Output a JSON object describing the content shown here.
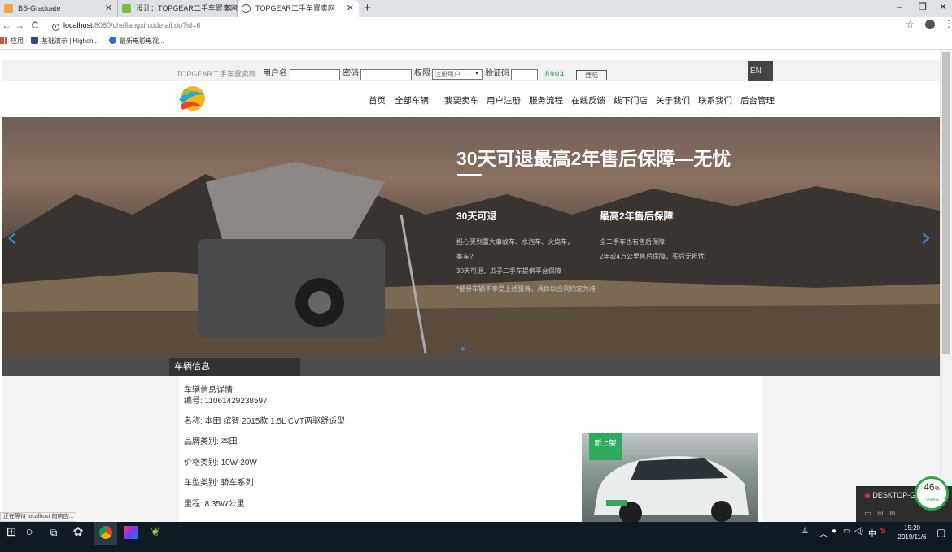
{
  "browser": {
    "tabs": [
      {
        "title": "BS-Graduate",
        "icon": "bs-graduate-favicon",
        "color": "#f3a73a"
      },
      {
        "title": "设计：TOPGEAR二手车置卖网",
        "icon": "leaf-favicon",
        "color": "#7dbd3b"
      },
      {
        "title": "TOPGEAR二手车置卖网",
        "icon": "globe-favicon",
        "color": "#555555"
      }
    ],
    "new_tab": "+",
    "window_controls": {
      "minimize": "–",
      "restore": "❐",
      "close": "✕"
    },
    "nav": {
      "back": "←",
      "forward": "→",
      "reload": "C"
    },
    "url": {
      "host": "localhost",
      "path": ":8080/chellangxinxidetail.do?id=6"
    },
    "bookmarks": [
      {
        "label": "应用",
        "icon": "apps-grid-icon"
      },
      {
        "label": "基础演示 | Highch...",
        "icon": "highcharts-icon"
      },
      {
        "label": "最新电影电视...",
        "icon": "video-play-icon"
      }
    ],
    "status_text": "正在等待 localhost 的响应..."
  },
  "site": {
    "brand": "TOPGEAR二手车置卖网",
    "login": {
      "username_label": "用户名",
      "password_label": "密码",
      "role_label": "权限",
      "role_value": "注册用户",
      "captcha_label": "验证码",
      "captcha_code": "8904",
      "login_button": "登陆"
    },
    "lang_button": "EN",
    "nav": [
      "首页",
      "全部车辆",
      "我要卖车",
      "用户注册",
      "服务流程",
      "在线反馈",
      "线下门店",
      "关于我们",
      "联系我们",
      "后台管理"
    ]
  },
  "hero": {
    "title": "30天可退最高2年售后保障—无忧",
    "left": {
      "heading": "30天可退",
      "lines": [
        "担心买到重大事故车、水泡车、火烧车，",
        "案车?",
        "30天可退，瓜子二手车提供平台保障",
        "*部分车辆不享受上述服务，具体以合同约定为准"
      ]
    },
    "right": {
      "heading": "最高2年售后保障",
      "lines": [
        "全二手车也有售后保障",
        "2年或4万公里售后保障，买后无担忧"
      ]
    },
    "prev": "‹",
    "next": "›"
  },
  "vehicle": {
    "tab_label": "车辆信息",
    "detail_header": "车辆信息详情:",
    "fields": [
      {
        "label": "编号:",
        "value": "11061429238597"
      },
      {
        "label": "名称:",
        "value": "本田 缤智 2015款 1.5L CVT两驱舒适型"
      },
      {
        "label": "品牌类别:",
        "value": "本田"
      },
      {
        "label": "价格类别:",
        "value": "10W-20W"
      },
      {
        "label": "车型类别:",
        "value": "轿车系列"
      },
      {
        "label": "里程:",
        "value": "8.35W公里"
      }
    ],
    "badge": "新上架"
  },
  "widget": {
    "label": "DESKTOP-G",
    "percent": "46",
    "percent_unit": "%",
    "speed": "↑168K/s"
  },
  "taskbar": {
    "time": "15:20",
    "date": "2019/11/6",
    "ime": "中",
    "tray_icons": [
      "person-icon",
      "chevron-up-icon",
      "notification-icon",
      "network-icon",
      "volume-icon"
    ]
  }
}
